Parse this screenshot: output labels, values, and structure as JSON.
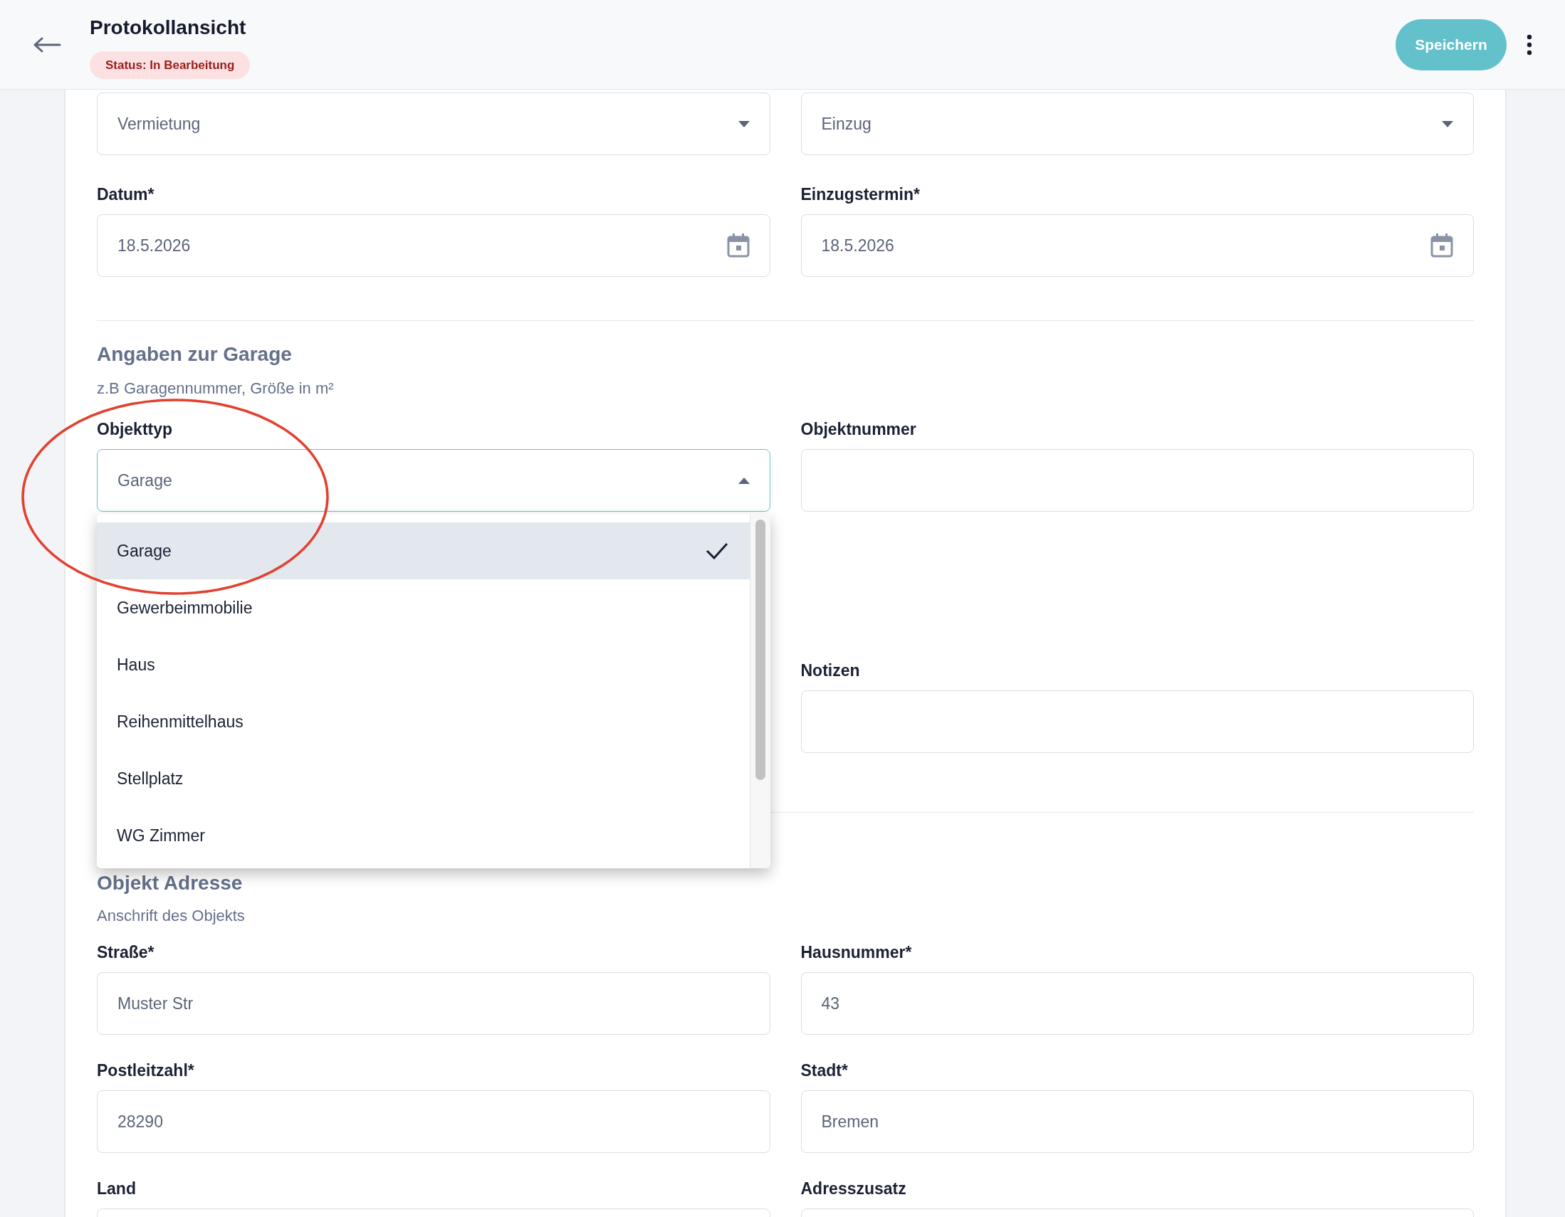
{
  "header": {
    "title": "Protokollansicht",
    "status": "Status: In Bearbeitung",
    "save_button": "Speichern"
  },
  "form": {
    "top_selects": [
      {
        "value": "Vermietung"
      },
      {
        "value": "Einzug"
      }
    ],
    "date_fields": [
      {
        "label": "Datum*",
        "value": "18.5.2026"
      },
      {
        "label": "Einzugstermin*",
        "value": "18.5.2026"
      }
    ],
    "garage_section": {
      "title": "Angaben zur Garage",
      "subtitle": "z.B Garagennummer, Größe in m²",
      "object_type": {
        "label": "Objekttyp",
        "value": "Garage",
        "expanded": true,
        "options": [
          {
            "label": "Garage",
            "selected": true
          },
          {
            "label": "Gewerbeimmobilie",
            "selected": false
          },
          {
            "label": "Haus",
            "selected": false
          },
          {
            "label": "Reihenmittelhaus",
            "selected": false
          },
          {
            "label": "Stellplatz",
            "selected": false
          },
          {
            "label": "WG Zimmer",
            "selected": false
          }
        ]
      },
      "object_number": {
        "label": "Objektnummer"
      },
      "notes": {
        "label": "Notizen"
      }
    },
    "address_section": {
      "title": "Objekt Adresse",
      "subtitle": "Anschrift des Objekts",
      "fields": [
        {
          "label": "Straße*",
          "value": "Muster Str"
        },
        {
          "label": "Hausnummer*",
          "value": "43"
        },
        {
          "label": "Postleitzahl*",
          "value": "28290"
        },
        {
          "label": "Stadt*",
          "value": "Bremen"
        },
        {
          "label": "Land"
        },
        {
          "label": "Adresszusatz"
        }
      ]
    }
  }
}
